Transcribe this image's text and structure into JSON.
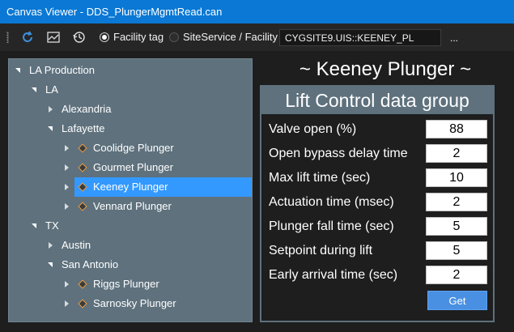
{
  "window": {
    "title": "Canvas Viewer - DDS_PlungerMgmtRead.can"
  },
  "toolbar": {
    "refresh_icon": "refresh-icon",
    "chart_icon": "chart-icon",
    "history_icon": "history-icon",
    "radio_facility_tag": "Facility tag",
    "radio_site_service": "SiteService / Facility",
    "path_value": "CYGSITE9.UIS::KEENEY_PL",
    "more_label": "..."
  },
  "tree": {
    "nodes": [
      {
        "label": "LA Production"
      },
      {
        "label": "LA"
      },
      {
        "label": "Alexandria"
      },
      {
        "label": "Lafayette"
      },
      {
        "label": "Coolidge Plunger"
      },
      {
        "label": "Gourmet Plunger"
      },
      {
        "label": "Keeney Plunger"
      },
      {
        "label": "Vennard Plunger"
      },
      {
        "label": "TX"
      },
      {
        "label": "Austin"
      },
      {
        "label": "San Antonio"
      },
      {
        "label": "Riggs Plunger"
      },
      {
        "label": "Sarnosky Plunger"
      }
    ]
  },
  "panel": {
    "title": "~ Keeney Plunger ~",
    "group_title": "Lift Control data group",
    "fields": [
      {
        "label": "Valve open (%)",
        "value": "88"
      },
      {
        "label": "Open bypass delay time",
        "value": "2"
      },
      {
        "label": "Max lift time (sec)",
        "value": "10"
      },
      {
        "label": "Actuation time (msec)",
        "value": "2"
      },
      {
        "label": "Plunger fall time (sec)",
        "value": "5"
      },
      {
        "label": "Setpoint during lift",
        "value": "5"
      },
      {
        "label": "Early arrival time (sec)",
        "value": "2"
      }
    ],
    "get_label": "Get"
  },
  "colors": {
    "titlebar": "#0a78d4",
    "tree_bg": "#5e717d",
    "selected": "#3399ff",
    "diamond": "#f1a44a",
    "button": "#4a90e2"
  }
}
